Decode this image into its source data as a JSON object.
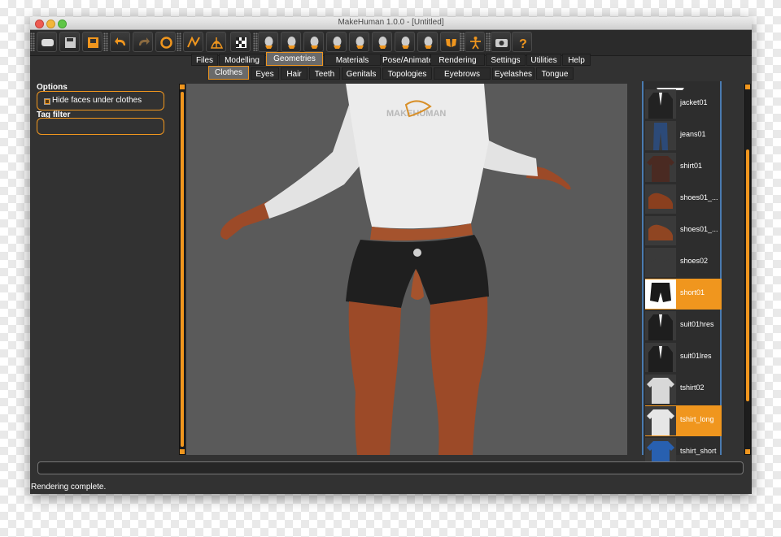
{
  "window": {
    "title": "MakeHuman 1.0.0 - [Untitled]"
  },
  "toolbar": {
    "buttons": [
      {
        "name": "undo-all-icon"
      },
      {
        "name": "save-icon"
      },
      {
        "name": "export-icon"
      },
      {
        "name": "undo-icon"
      },
      {
        "name": "redo-icon"
      },
      {
        "name": "reset-icon"
      },
      {
        "name": "smooth-icon"
      },
      {
        "name": "wireframe-icon"
      },
      {
        "name": "background-icon"
      },
      {
        "name": "front-view-icon"
      },
      {
        "name": "back-view-icon"
      },
      {
        "name": "left-view-icon"
      },
      {
        "name": "right-view-icon"
      },
      {
        "name": "top-view-icon"
      },
      {
        "name": "bottom-view-icon"
      },
      {
        "name": "reset-camera-icon"
      },
      {
        "name": "global-camera-icon"
      },
      {
        "name": "face-camera-icon"
      },
      {
        "name": "pose-icon"
      },
      {
        "name": "screenshot-icon"
      },
      {
        "name": "help-icon"
      }
    ]
  },
  "tabs": [
    "Files",
    "Modelling",
    "Geometries",
    "Materials",
    "Pose/Animate",
    "Rendering",
    "Settings",
    "Utilities",
    "Help"
  ],
  "active_tab": "Geometries",
  "subtabs": [
    "Clothes",
    "Eyes",
    "Hair",
    "Teeth",
    "Genitals",
    "Topologies",
    "Eyebrows",
    "Eyelashes",
    "Tongue"
  ],
  "active_subtab": "Clothes",
  "options": {
    "title": "Options",
    "hide_faces_label": "Hide faces under clothes",
    "hide_faces_checked": true,
    "tag_filter_title": "Tag filter"
  },
  "viewport": {
    "shirt_logo_text": "MAKEHUMAN"
  },
  "clothes": [
    {
      "label": "jacket01",
      "selected": false,
      "color": "#222222",
      "kind": "jacket"
    },
    {
      "label": "jeans01",
      "selected": false,
      "color": "#2c4a78",
      "kind": "pants"
    },
    {
      "label": "shirt01",
      "selected": false,
      "color": "#4a2a22",
      "kind": "shirt"
    },
    {
      "label": "shoes01_...",
      "selected": false,
      "color": "#8a3f1e",
      "kind": "shoe"
    },
    {
      "label": "shoes01_...",
      "selected": false,
      "color": "#8f4522",
      "kind": "shoe"
    },
    {
      "label": "shoes02",
      "selected": false,
      "color": "#3a3a3a",
      "kind": "shoe2"
    },
    {
      "label": "short01",
      "selected": true,
      "color": "#1a1a1a",
      "kind": "short"
    },
    {
      "label": "suit01hres",
      "selected": false,
      "color": "#1e1e1e",
      "kind": "jacket"
    },
    {
      "label": "suit01lres",
      "selected": false,
      "color": "#1e1e1e",
      "kind": "jacket"
    },
    {
      "label": "tshirt02",
      "selected": false,
      "color": "#d8d8d8",
      "kind": "shirt"
    },
    {
      "label": "tshirt_long",
      "selected": true,
      "color": "#e6e6e6",
      "kind": "shirt"
    },
    {
      "label": "tshirt_short",
      "selected": false,
      "color": "#2860b0",
      "kind": "shirt"
    }
  ],
  "status": {
    "text": "Rendering complete."
  },
  "colors": {
    "accent": "#f0961e",
    "panel": "#323232",
    "viewport": "#5a5a5a",
    "list_border": "#4a7bb0"
  }
}
